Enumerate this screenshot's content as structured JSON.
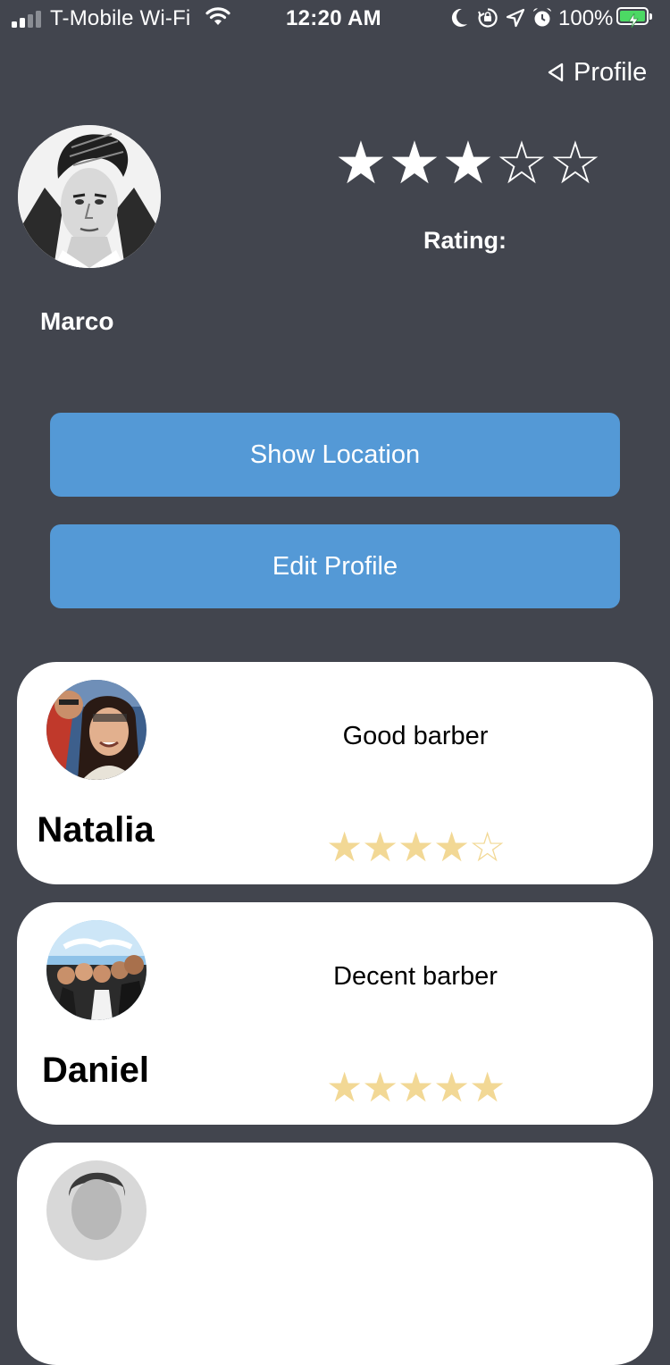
{
  "status_bar": {
    "carrier": "T-Mobile Wi-Fi",
    "time": "12:20 AM",
    "battery": "100%",
    "icons": [
      "signal-icon",
      "wifi-icon",
      "moon-icon",
      "rotation-lock-icon",
      "location-arrow-icon",
      "alarm-icon",
      "battery-icon"
    ]
  },
  "nav": {
    "back_label": "Profile",
    "back_icon": "triangle-back-icon"
  },
  "profile": {
    "name": "Marco",
    "rating_label": "Rating:",
    "rating_value": 3,
    "rating_max": 5
  },
  "actions": {
    "show_location": "Show Location",
    "edit_profile": "Edit Profile"
  },
  "reviews": [
    {
      "name": "Natalia",
      "text": "Good barber",
      "stars": 4,
      "max": 5
    },
    {
      "name": "Daniel",
      "text": "Decent barber",
      "stars": 5,
      "max": 5
    },
    {
      "name": "",
      "text": "",
      "stars": 0,
      "max": 5
    }
  ],
  "colors": {
    "background": "#42454e",
    "button": "#5499d6",
    "card": "#ffffff",
    "review_star": "#f2d895",
    "battery_fill": "#4cd964"
  }
}
